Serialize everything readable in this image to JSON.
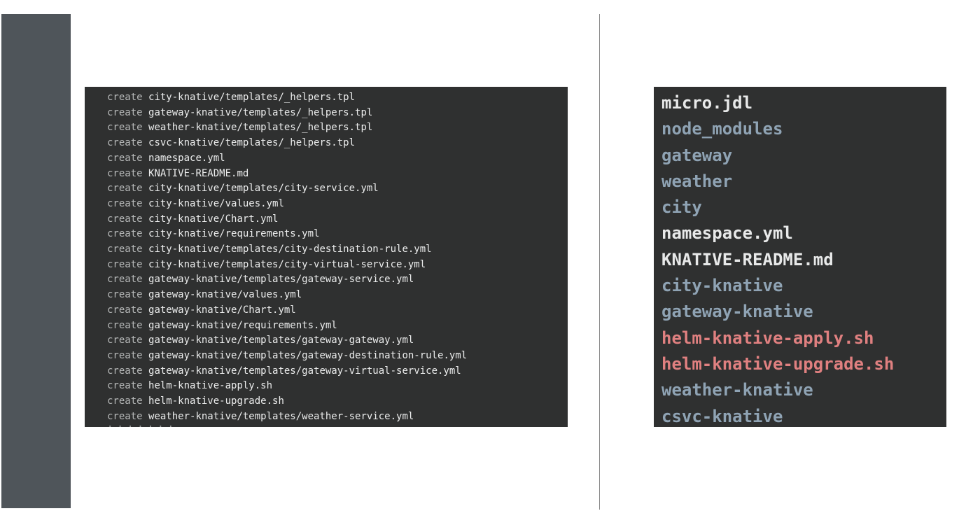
{
  "terminal": {
    "keyword": "create",
    "lines": [
      "city-knative/templates/_helpers.tpl",
      "gateway-knative/templates/_helpers.tpl",
      "weather-knative/templates/_helpers.tpl",
      "csvc-knative/templates/_helpers.tpl",
      "namespace.yml",
      "KNATIVE-README.md",
      "city-knative/templates/city-service.yml",
      "city-knative/values.yml",
      "city-knative/Chart.yml",
      "city-knative/requirements.yml",
      "city-knative/templates/city-destination-rule.yml",
      "city-knative/templates/city-virtual-service.yml",
      "gateway-knative/templates/gateway-service.yml",
      "gateway-knative/values.yml",
      "gateway-knative/Chart.yml",
      "gateway-knative/requirements.yml",
      "gateway-knative/templates/gateway-gateway.yml",
      "gateway-knative/templates/gateway-destination-rule.yml",
      "gateway-knative/templates/gateway-virtual-service.yml",
      "helm-knative-apply.sh",
      "helm-knative-upgrade.sh",
      "weather-knative/templates/weather-service.yml"
    ]
  },
  "listing": {
    "colors": {
      "file": "#e8e9e9",
      "directory": "#8fa3b4",
      "executable": "#e08080"
    },
    "items": [
      {
        "name": "micro.jdl",
        "kind": "file"
      },
      {
        "name": "node_modules",
        "kind": "directory"
      },
      {
        "name": "gateway",
        "kind": "directory"
      },
      {
        "name": "weather",
        "kind": "directory"
      },
      {
        "name": "city",
        "kind": "directory"
      },
      {
        "name": "namespace.yml",
        "kind": "file"
      },
      {
        "name": "KNATIVE-README.md",
        "kind": "file"
      },
      {
        "name": "city-knative",
        "kind": "directory"
      },
      {
        "name": "gateway-knative",
        "kind": "directory"
      },
      {
        "name": "helm-knative-apply.sh",
        "kind": "executable"
      },
      {
        "name": "helm-knative-upgrade.sh",
        "kind": "executable"
      },
      {
        "name": "weather-knative",
        "kind": "directory"
      },
      {
        "name": "csvc-knative",
        "kind": "directory"
      }
    ]
  }
}
